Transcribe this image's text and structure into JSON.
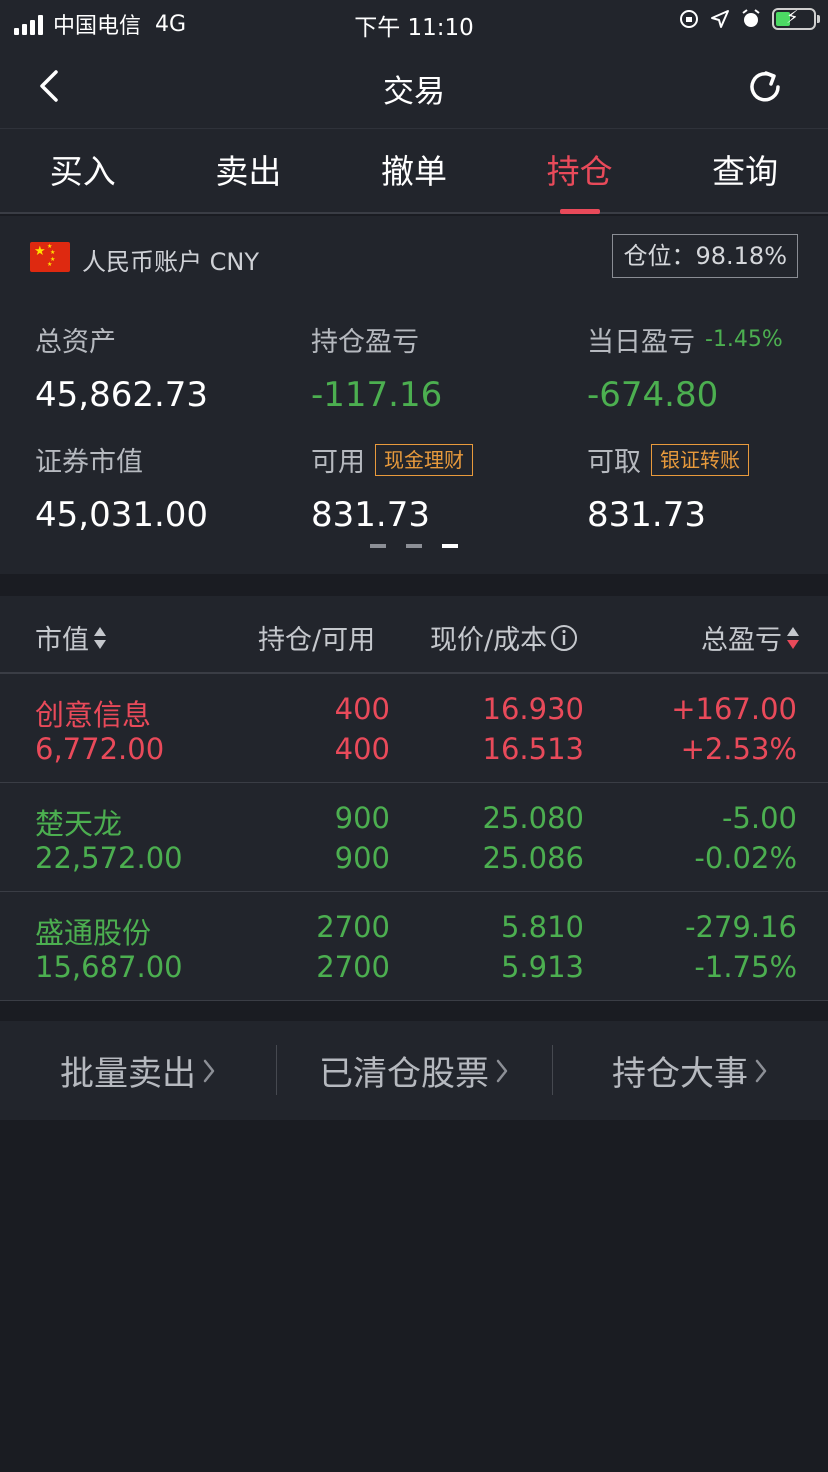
{
  "status_bar": {
    "carrier": "中国电信",
    "network": "4G",
    "time": "下午 11:10"
  },
  "nav": {
    "title": "交易",
    "back_icon": "chevron-left-icon",
    "refresh_icon": "refresh-icon"
  },
  "tabs": [
    {
      "label": "买入"
    },
    {
      "label": "卖出"
    },
    {
      "label": "撤单"
    },
    {
      "label": "持仓",
      "active": true
    },
    {
      "label": "查询"
    }
  ],
  "account": {
    "name": "人民币账户 CNY",
    "position_ratio": "仓位：98.18%",
    "total_assets_label": "总资产",
    "total_assets": "45,862.73",
    "holding_pl_label": "持仓盈亏",
    "holding_pl": "-117.16",
    "daily_pl_label": "当日盈亏",
    "daily_pl_pct": "-1.45%",
    "daily_pl": "-674.80",
    "market_value_label": "证券市值",
    "market_value": "45,031.00",
    "available_label": "可用",
    "cash_tag": "现金理财",
    "available": "831.73",
    "withdrawable_label": "可取",
    "transfer_tag": "银证转账",
    "withdrawable": "831.73"
  },
  "table": {
    "headers": {
      "market_value": "市值",
      "holding": "持仓/可用",
      "price": "现价/成本",
      "total_pl": "总盈亏"
    },
    "rows": [
      {
        "name": "创意信息",
        "market_value": "6,772.00",
        "holding": "400",
        "available": "400",
        "price": "16.930",
        "cost": "16.513",
        "pl": "+167.00",
        "pl_pct": "+2.53%",
        "color": "red"
      },
      {
        "name": "楚天龙",
        "market_value": "22,572.00",
        "holding": "900",
        "available": "900",
        "price": "25.080",
        "cost": "25.086",
        "pl": "-5.00",
        "pl_pct": "-0.02%",
        "color": "green"
      },
      {
        "name": "盛通股份",
        "market_value": "15,687.00",
        "holding": "2700",
        "available": "2700",
        "price": "5.810",
        "cost": "5.913",
        "pl": "-279.16",
        "pl_pct": "-1.75%",
        "color": "green"
      }
    ]
  },
  "actions": [
    {
      "label": "批量卖出"
    },
    {
      "label": "已清仓股票"
    },
    {
      "label": "持仓大事"
    }
  ],
  "colors": {
    "accent_red": "#e94a5a",
    "gain_green": "#4caf50",
    "tag_orange": "#e89a3c",
    "background": "#1a1c22",
    "panel": "#22252c"
  }
}
